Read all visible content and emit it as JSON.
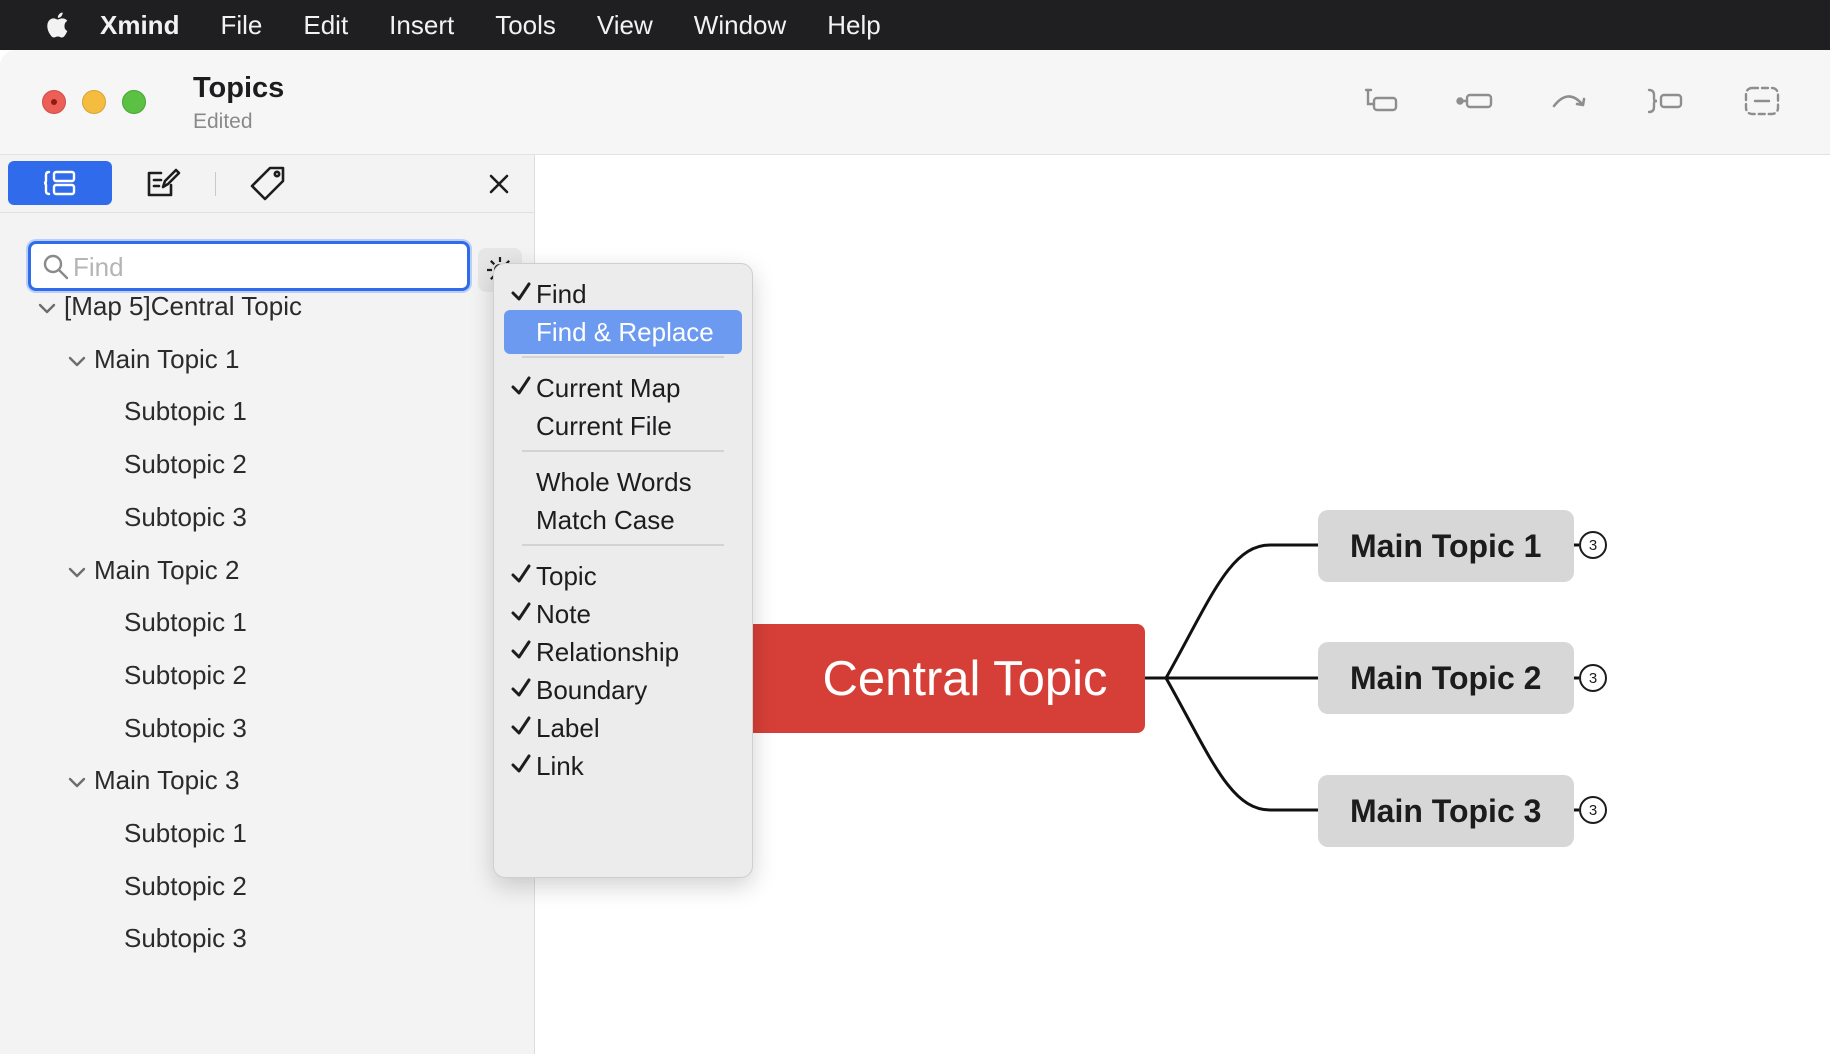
{
  "menubar": {
    "items": [
      {
        "label": "Xmind",
        "bold": true
      },
      {
        "label": "File"
      },
      {
        "label": "Edit"
      },
      {
        "label": "Insert"
      },
      {
        "label": "Tools"
      },
      {
        "label": "View"
      },
      {
        "label": "Window"
      },
      {
        "label": "Help"
      }
    ]
  },
  "window": {
    "title": "Topics",
    "subtitle": "Edited",
    "toolbar_icons": [
      "insert-subtopic-icon",
      "insert-topic-icon",
      "relationship-icon",
      "summary-icon",
      "boundary-icon"
    ]
  },
  "sidebar": {
    "tabs": [
      "outline-icon",
      "note-icon",
      "label-icon"
    ],
    "search_placeholder": "Find",
    "search_value": "",
    "tree": [
      {
        "label": "[Map 5]Central Topic",
        "level": 0,
        "expanded": true
      },
      {
        "label": "Main Topic 1",
        "level": 1,
        "expanded": true
      },
      {
        "label": "Subtopic 1",
        "level": 2
      },
      {
        "label": "Subtopic 2",
        "level": 2
      },
      {
        "label": "Subtopic 3",
        "level": 2
      },
      {
        "label": "Main Topic 2",
        "level": 1,
        "expanded": true
      },
      {
        "label": "Subtopic 1",
        "level": 2
      },
      {
        "label": "Subtopic 2",
        "level": 2
      },
      {
        "label": "Subtopic 3",
        "level": 2
      },
      {
        "label": "Main Topic 3",
        "level": 1,
        "expanded": true
      },
      {
        "label": "Subtopic 1",
        "level": 2
      },
      {
        "label": "Subtopic 2",
        "level": 2
      },
      {
        "label": "Subtopic 3",
        "level": 2
      }
    ]
  },
  "menu": {
    "groups": [
      [
        {
          "label": "Find",
          "checked": true
        },
        {
          "label": "Find & Replace",
          "checked": false,
          "highlighted": true
        }
      ],
      [
        {
          "label": "Current Map",
          "checked": true
        },
        {
          "label": "Current File",
          "checked": false
        }
      ],
      [
        {
          "label": "Whole Words",
          "checked": false
        },
        {
          "label": "Match Case",
          "checked": false
        }
      ],
      [
        {
          "label": "Topic",
          "checked": true
        },
        {
          "label": "Note",
          "checked": true
        },
        {
          "label": "Relationship",
          "checked": true
        },
        {
          "label": "Boundary",
          "checked": true
        },
        {
          "label": "Label",
          "checked": true
        },
        {
          "label": "Link",
          "checked": true
        }
      ]
    ]
  },
  "map": {
    "central": "Central Topic",
    "central_color": "#d63f37",
    "main_topics": [
      {
        "label": "Main Topic 1",
        "collapsed_count": "3"
      },
      {
        "label": "Main Topic 2",
        "collapsed_count": "3"
      },
      {
        "label": "Main Topic 3",
        "collapsed_count": "3"
      }
    ]
  },
  "colors": {
    "accent": "#2f6bea",
    "menu_highlight": "#6b9af0",
    "main_topic_fill": "#d7d7d7"
  }
}
